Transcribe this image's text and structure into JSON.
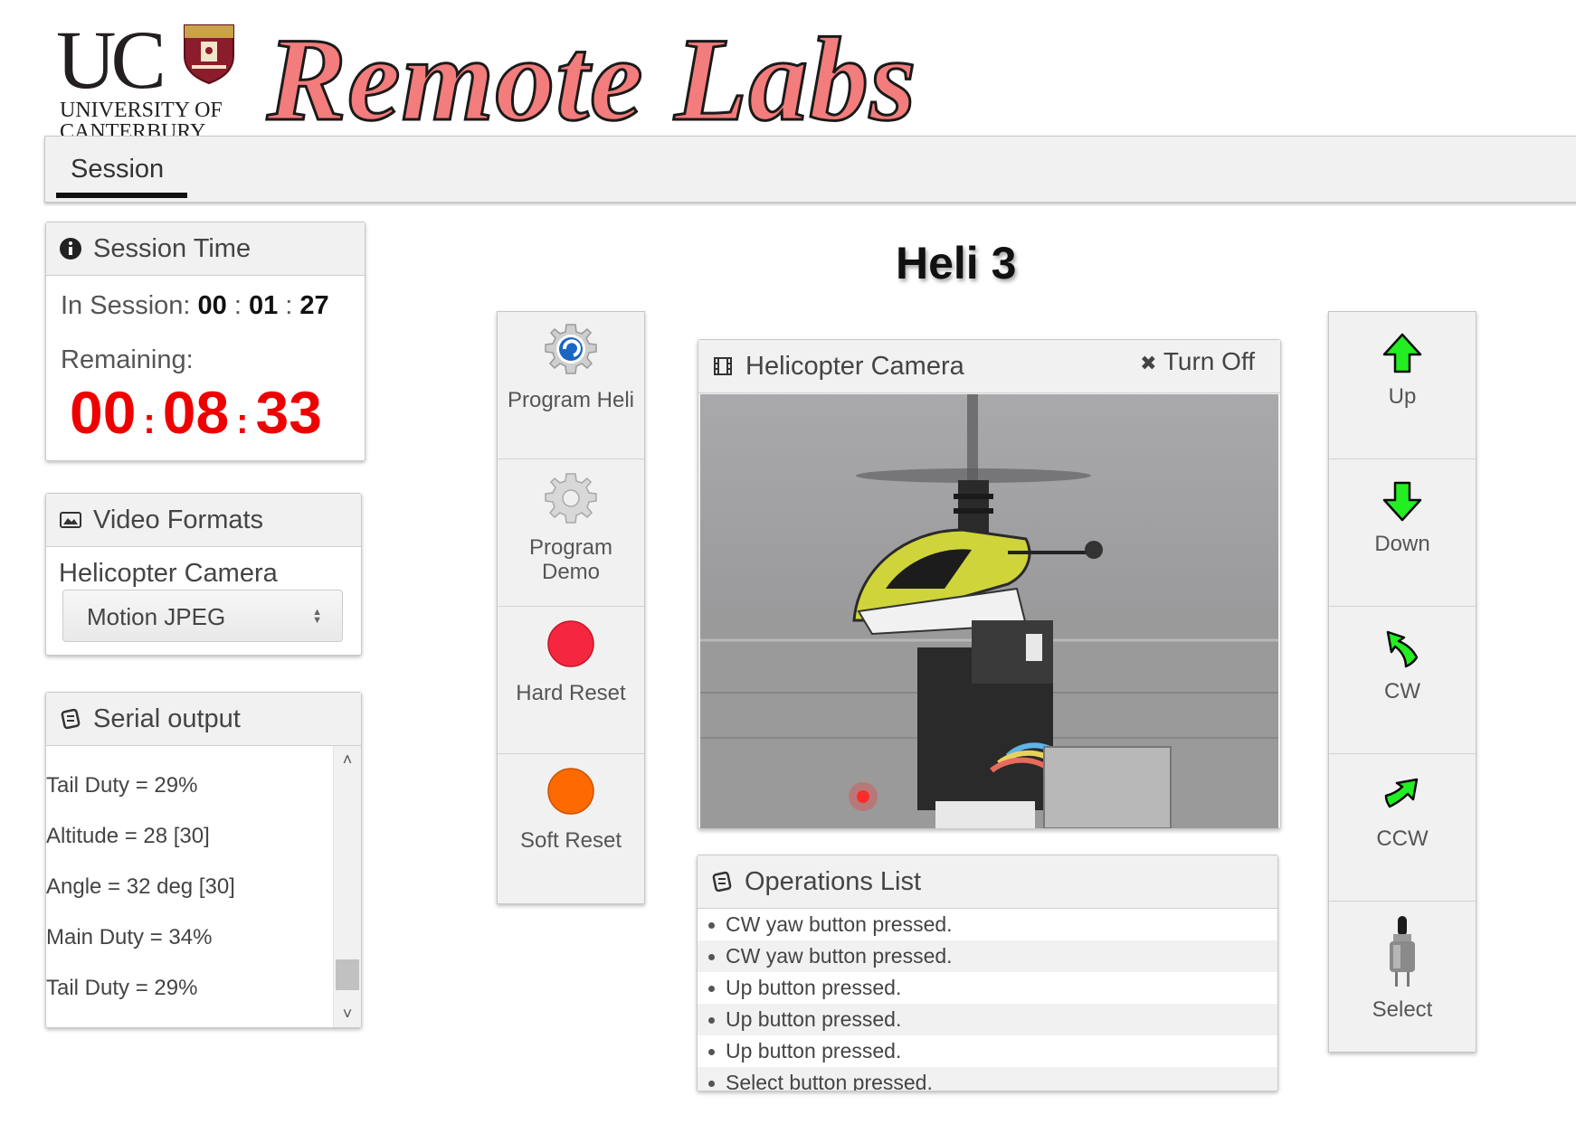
{
  "header": {
    "logo": {
      "letters": "UC",
      "line1": "UNIVERSITY OF",
      "line2": "CANTERBURY"
    },
    "site_title": "Remote Labs"
  },
  "tabs": [
    {
      "label": "Session",
      "active": true
    }
  ],
  "session_time": {
    "title": "Session Time",
    "in_session_label": "In Session:",
    "in_session": {
      "hh": "00",
      "mm": "01",
      "ss": "27"
    },
    "remaining_label": "Remaining:",
    "remaining": {
      "hh": "00",
      "mm": "08",
      "ss": "33"
    }
  },
  "video_formats": {
    "title": "Video Formats",
    "camera_label": "Helicopter Camera",
    "selected_format": "Motion JPEG"
  },
  "serial_output": {
    "title": "Serial output",
    "lines": [
      "Tail Duty = 29%",
      "Altitude = 28 [30]",
      "Angle = 32 deg [30]",
      "Main Duty = 34%",
      "Tail Duty = 29%"
    ]
  },
  "rig_title": "Heli 3",
  "left_buttons": [
    {
      "label": "Program Heli",
      "icon": "gear-blue-icon"
    },
    {
      "label": "Program Demo",
      "icon": "gear-grey-icon"
    },
    {
      "label": "Hard Reset",
      "icon": "red-circle-icon",
      "color": "#f5273f"
    },
    {
      "label": "Soft Reset",
      "icon": "orange-circle-icon",
      "color": "#ff6a00"
    }
  ],
  "camera": {
    "title": "Helicopter Camera",
    "turn_off_label": "Turn Off"
  },
  "operations": {
    "title": "Operations List",
    "items": [
      "CW yaw button pressed.",
      "CW yaw button pressed.",
      "Up button pressed.",
      "Up button pressed.",
      "Up button pressed.",
      "Select button pressed."
    ]
  },
  "right_buttons": [
    {
      "label": "Up",
      "icon": "arrow-up-icon"
    },
    {
      "label": "Down",
      "icon": "arrow-down-icon"
    },
    {
      "label": "CW",
      "icon": "rotate-cw-icon"
    },
    {
      "label": "CCW",
      "icon": "rotate-ccw-icon"
    },
    {
      "label": "Select",
      "icon": "push-switch-icon"
    }
  ],
  "colors": {
    "title_fill": "#f37c7c",
    "timer_red": "#ee0000",
    "arrow_green": "#22ee22"
  }
}
